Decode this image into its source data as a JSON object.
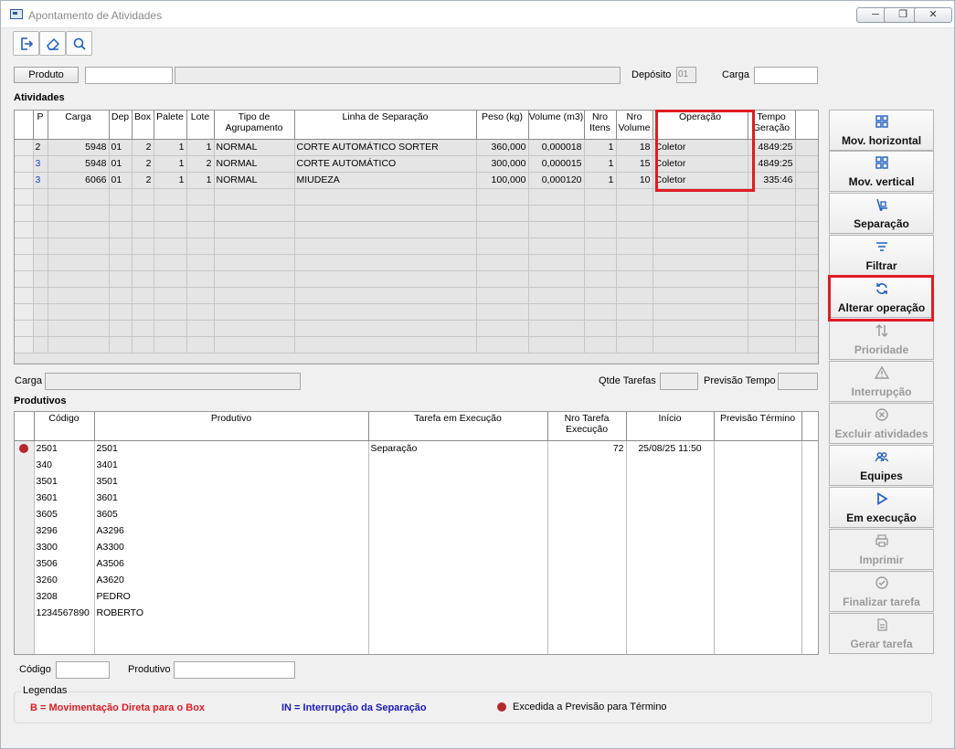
{
  "window": {
    "title": "Apontamento de Atividades"
  },
  "filter": {
    "produto_button": "Produto",
    "produto_code": "",
    "produto_desc": "",
    "deposito_label": "Depósito",
    "deposito_value": "01",
    "carga_label": "Carga",
    "carga_value": ""
  },
  "atividades": {
    "title": "Atividades",
    "columns": [
      "P",
      "Carga",
      "Dep",
      "Box",
      "Palete",
      "Lote",
      "Tipo de Agrupamento",
      "Linha de Separação",
      "Peso (kg)",
      "Volume (m3)",
      "Nro Itens",
      "Nro Volume",
      "Operação",
      "Tempo Geração"
    ],
    "rows": [
      [
        "2",
        "5948",
        "01",
        "2",
        "1",
        "1",
        "NORMAL",
        "CORTE AUTOMÁTICO SORTER",
        "360,000",
        "0,000018",
        "1",
        "18",
        "Coletor",
        "4849:25"
      ],
      [
        "3",
        "5948",
        "01",
        "2",
        "1",
        "2",
        "NORMAL",
        "CORTE AUTOMÁTICO",
        "300,000",
        "0,000015",
        "1",
        "15",
        "Coletor",
        "4849:25"
      ],
      [
        "3",
        "6066",
        "01",
        "2",
        "1",
        "1",
        "NORMAL",
        "MIUDEZA",
        "100,000",
        "0,000120",
        "1",
        "10",
        "Coletor",
        "335:46"
      ]
    ]
  },
  "summary": {
    "carga_label": "Carga",
    "carga_value": "",
    "qtde_tarefas_label": "Qtde Tarefas",
    "qtde_tarefas_value": "",
    "previsao_label": "Previsão Tempo",
    "previsao_value": ""
  },
  "produtivos": {
    "title": "Produtivos",
    "columns": [
      "Código",
      "Produtivo",
      "Tarefa em Execução",
      "Nro Tarefa Execução",
      "Início",
      "Previsão Término"
    ],
    "rows": [
      [
        "2501",
        "2501",
        "Separação",
        "72",
        "25/08/25  11:50",
        ""
      ],
      [
        "340",
        "3401",
        "",
        "",
        "",
        ""
      ],
      [
        "3501",
        "3501",
        "",
        "",
        "",
        ""
      ],
      [
        "3601",
        "3601",
        "",
        "",
        "",
        ""
      ],
      [
        "3605",
        "3605",
        "",
        "",
        "",
        ""
      ],
      [
        "3296",
        "A3296",
        "",
        "",
        "",
        ""
      ],
      [
        "3300",
        "A3300",
        "",
        "",
        "",
        ""
      ],
      [
        "3506",
        "A3506",
        "",
        "",
        "",
        ""
      ],
      [
        "3260",
        "A3620",
        "",
        "",
        "",
        ""
      ],
      [
        "3208",
        "PEDRO",
        "",
        "",
        "",
        ""
      ],
      [
        "1234567890",
        "ROBERTO",
        "",
        "",
        "",
        ""
      ]
    ],
    "first_row_marker": "red-dot"
  },
  "bottom": {
    "codigo_label": "Código",
    "codigo_value": "",
    "produtivo_label": "Produtivo",
    "produtivo_value": ""
  },
  "legend": {
    "title": "Legendas",
    "b_text": "B = Movimentação Direta para o Box",
    "in_text": "IN = Interrupção da Separação",
    "dot_text": "Excedida a Previsão para Término",
    "b_color": "#e01b24",
    "in_color": "#1a1ab8",
    "dot_color": "#b5282a"
  },
  "side_buttons": [
    {
      "label": "Mov. horizontal",
      "icon": "grid-move-icon",
      "enabled": true
    },
    {
      "label": "Mov. vertical",
      "icon": "grid-move-icon",
      "enabled": true
    },
    {
      "label": "Separação",
      "icon": "hand-truck-icon",
      "enabled": true
    },
    {
      "label": "Filtrar",
      "icon": "filter-icon",
      "enabled": true
    },
    {
      "label": "Alterar operação",
      "icon": "refresh-icon",
      "enabled": true
    },
    {
      "label": "Prioridade",
      "icon": "sort-arrows-icon",
      "enabled": false
    },
    {
      "label": "Interrupção",
      "icon": "warning-icon",
      "enabled": false
    },
    {
      "label": "Excluir atividades",
      "icon": "delete-circle-icon",
      "enabled": false
    },
    {
      "label": "Equipes",
      "icon": "team-icon",
      "enabled": true
    },
    {
      "label": "Em execução",
      "icon": "play-icon",
      "enabled": true
    },
    {
      "label": "Imprimir",
      "icon": "printer-icon",
      "enabled": false
    },
    {
      "label": "Finalizar tarefa",
      "icon": "check-circle-icon",
      "enabled": false
    },
    {
      "label": "Gerar tarefa",
      "icon": "document-icon",
      "enabled": false
    }
  ],
  "colors": {
    "highlight_red": "#e01b24",
    "accent_blue": "#1f5fbf"
  }
}
